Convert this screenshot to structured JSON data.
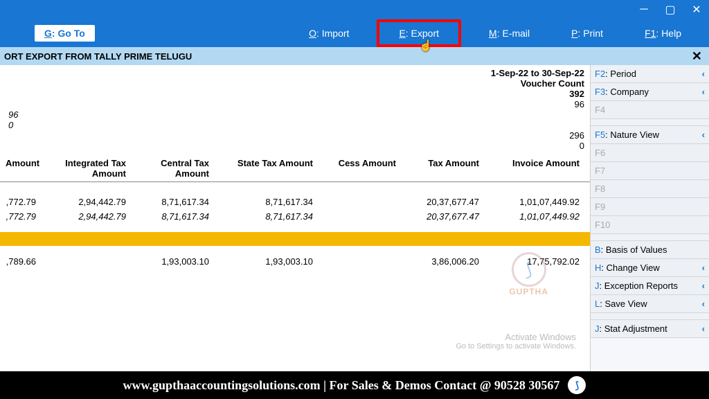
{
  "titlebar": {
    "min": "─",
    "max": "▢",
    "close": "✕"
  },
  "menubar": {
    "goto_k": "G",
    "goto_l": ": Go To",
    "import_k": "O",
    "import_l": ": Import",
    "export_k": "E",
    "export_l": ": Export",
    "email_k": "M",
    "email_l": ": E-mail",
    "print_k": "P",
    "print_l": ": Print",
    "help_k": "F1",
    "help_l": ": Help"
  },
  "subheader": {
    "title": "ORT EXPORT FROM TALLY PRIME TELUGU",
    "close": "✕"
  },
  "period": "1-Sep-22 to 30-Sep-22",
  "voucher_label": "Voucher Count",
  "totals": {
    "t1": "392",
    "t2": "96",
    "l1": "96",
    "l2": "0",
    "t3": "296",
    "t4": "0"
  },
  "headers": {
    "h1": "Amount",
    "h2": "Integrated Tax Amount",
    "h3": "Central Tax Amount",
    "h4": "State Tax Amount",
    "h5": "Cess Amount",
    "h6": "Tax Amount",
    "h7": "Invoice Amount"
  },
  "rows": [
    {
      "c1": ",772.79",
      "c2": "2,94,442.79",
      "c3": "8,71,617.34",
      "c4": "8,71,617.34",
      "c5": "",
      "c6": "20,37,677.47",
      "c7": "1,01,07,449.92"
    },
    {
      "c1": ",772.79",
      "c2": "2,94,442.79",
      "c3": "8,71,617.34",
      "c4": "8,71,617.34",
      "c5": "",
      "c6": "20,37,677.47",
      "c7": "1,01,07,449.92"
    }
  ],
  "row_after": {
    "c1": ",789.66",
    "c2": "",
    "c3": "1,93,003.10",
    "c4": "1,93,003.10",
    "c5": "",
    "c6": "3,86,006.20",
    "c7": "17,75,792.02"
  },
  "side": {
    "period_k": "F2",
    "period_l": ": Period",
    "company_k": "F3",
    "company_l": ": Company",
    "f4": "F4",
    "nature_k": "F5",
    "nature_l": ": Nature View",
    "f6": "F6",
    "f7": "F7",
    "f8": "F8",
    "f9": "F9",
    "f10": "F10",
    "basis_k": "B",
    "basis_l": ": Basis of Values",
    "change_k": "H",
    "change_l": ": Change View",
    "except_k": "J",
    "except_l": ": Exception Reports",
    "save_k": "L",
    "save_l": ": Save View",
    "stat_k": "J",
    "stat_l": ": Stat Adjustment"
  },
  "chev": "‹",
  "watermark": {
    "logo": "⟆",
    "text": "GUPTHA"
  },
  "activate": {
    "l1": "Activate Windows",
    "l2": "Go to Settings to activate Windows."
  },
  "footer": "www.gupthaaccountingsolutions.com | For Sales & Demos Contact @ 90528 30567",
  "footer_logo": "⟆"
}
